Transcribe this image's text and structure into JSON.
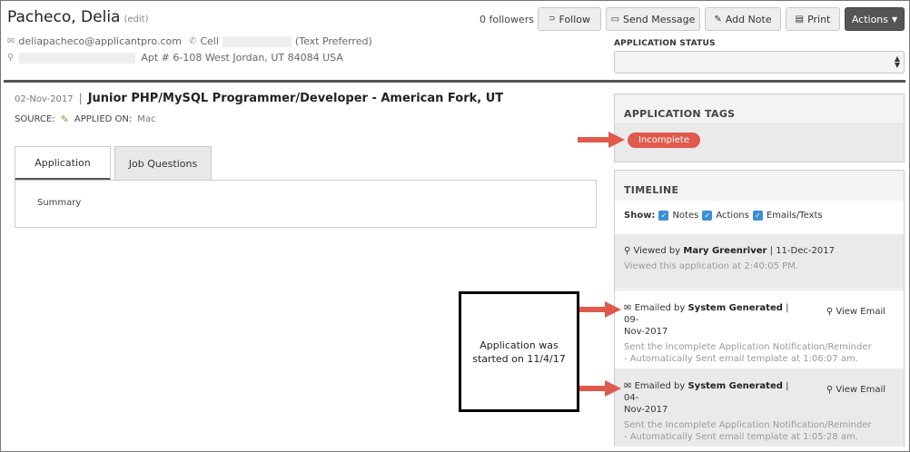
{
  "header": {
    "name": "Pacheco, Delia",
    "edit_label": "(edit)",
    "email": "deliapacheco@applicantpro.com",
    "phone_label": "Cell",
    "phone_note": "(Text Preferred)",
    "address": "Apt # 6-108 West Jordan, UT 84084 USA"
  },
  "toolbar": {
    "followers": "0 followers",
    "follow": "Follow",
    "send_message": "Send Message",
    "add_note": "Add Note",
    "print": "Print",
    "actions": "Actions"
  },
  "application_status": {
    "label": "APPLICATION STATUS",
    "value": ""
  },
  "job": {
    "date": "02-Nov-2017",
    "title": "Junior PHP/MySQL Programmer/Developer - American Fork, UT",
    "source_label": "SOURCE:",
    "applied_on_label": "APPLIED ON:",
    "applied_on_value": "Mac"
  },
  "tabs": [
    {
      "label": "Application",
      "active": true
    },
    {
      "label": "Job Questions",
      "active": false
    }
  ],
  "tab_content": {
    "summary": "Summary"
  },
  "application_tags": {
    "title": "APPLICATION TAGS",
    "tags": [
      {
        "label": "Incomplete",
        "color": "#e05a4b"
      }
    ]
  },
  "timeline": {
    "title": "TIMELINE",
    "show_label": "Show:",
    "filters": [
      {
        "label": "Notes",
        "checked": true
      },
      {
        "label": "Actions",
        "checked": true
      },
      {
        "label": "Emails/Texts",
        "checked": true
      }
    ],
    "entries": [
      {
        "icon": "search-icon",
        "prefix": "Viewed by",
        "who": "Mary Greenriver",
        "date": "11-Dec-2017",
        "body": "Viewed this application at 2:40:05 PM."
      },
      {
        "icon": "envelope-icon",
        "prefix": "Emailed by",
        "who": "System Generated",
        "date_a": "09-",
        "date_b": "Nov-2017",
        "action": "View Email",
        "body_1": "Sent the Incomplete Application Notification/Reminder",
        "body_2": "- Automatically Sent email template at 1:06:07 am."
      },
      {
        "icon": "envelope-icon",
        "prefix": "Emailed by",
        "who": "System Generated",
        "date_a": "04-",
        "date_b": "Nov-2017",
        "action": "View Email",
        "body_1": "Sent the Incomplete Application Notification/Reminder",
        "body_2": "- Automatically Sent email template at 1:05:28 am."
      }
    ]
  },
  "annotation": {
    "callout_line1": "Application was",
    "callout_line2": "started on 11/4/17",
    "arrow_color": "#e05a4b"
  }
}
